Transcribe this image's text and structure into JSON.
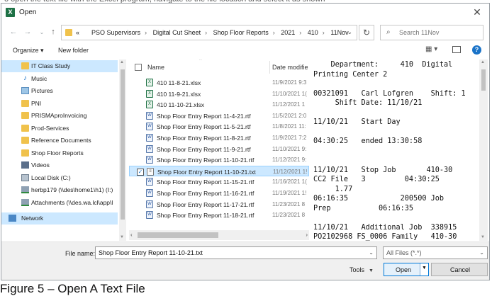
{
  "dialog": {
    "title": "Open",
    "close_glyph": "✕"
  },
  "nav": {
    "back": "←",
    "forward": "→",
    "recent": "⌄",
    "up": "↑",
    "breadcrumbs": [
      "«",
      "PSO Supervisors",
      "Digital Cut Sheet",
      "Shop Floor Reports",
      "2021",
      "410",
      "11Nov"
    ],
    "refresh": "↻",
    "search_placeholder": "Search 11Nov"
  },
  "toolbar": {
    "organize": "Organize ▾",
    "new_folder": "New folder",
    "view": "▦ ▾",
    "help": "?"
  },
  "sidebar": {
    "items": [
      {
        "label": "IT Class Study",
        "icon": "folder-icon",
        "selected": true
      },
      {
        "label": "Music",
        "icon": "music-icon"
      },
      {
        "label": "Pictures",
        "icon": "pictures-icon"
      },
      {
        "label": "PNI",
        "icon": "folder-icon"
      },
      {
        "label": "PRISMAproInvoicing",
        "icon": "folder-icon"
      },
      {
        "label": "Prod-Services",
        "icon": "folder-icon"
      },
      {
        "label": "Reference Documents",
        "icon": "folder-icon"
      },
      {
        "label": "Shop Floor Reports",
        "icon": "folder-icon"
      },
      {
        "label": "Videos",
        "icon": "videos-icon"
      },
      {
        "label": "Local Disk (C:)",
        "icon": "disk-icon"
      },
      {
        "label": "herbp179 (\\\\des\\home1\\h1) (I:)",
        "icon": "network-drive-icon"
      },
      {
        "label": "Attachments (\\\\des.wa.lcl\\app\\l",
        "icon": "network-drive-icon"
      },
      {
        "label": "Network",
        "icon": "network-icon",
        "selected": true
      }
    ]
  },
  "files": {
    "columns": {
      "name": "Name",
      "date": "Date modifie"
    },
    "rows": [
      {
        "name": "410 11-8-21.xlsx",
        "date": "11/9/2021 9:3",
        "type": "xl"
      },
      {
        "name": "410 11-9-21.xlsx",
        "date": "11/10/2021 1(",
        "type": "xl"
      },
      {
        "name": "410 11-10-21.xlsx",
        "date": "11/12/2021 1",
        "type": "xl"
      },
      {
        "name": "Shop Floor Entry Report 11-4-21.rtf",
        "date": "11/5/2021 2:0",
        "type": "rtf"
      },
      {
        "name": "Shop Floor Entry Report 11-5-21.rtf",
        "date": "11/8/2021 11:",
        "type": "rtf"
      },
      {
        "name": "Shop Floor Entry Report 11-8-21.rtf",
        "date": "11/9/2021 7:2",
        "type": "rtf"
      },
      {
        "name": "Shop Floor Entry Report 11-9-21.rtf",
        "date": "11/10/2021 9:",
        "type": "rtf"
      },
      {
        "name": "Shop Floor Entry Report 11-10-21.rtf",
        "date": "11/12/2021 9:",
        "type": "rtf"
      },
      {
        "name": "Shop Floor Entry Report 11-10-21.txt",
        "date": "11/12/2021 1!",
        "type": "txt",
        "selected": true
      },
      {
        "name": "Shop Floor Entry Report 11-15-21.rtf",
        "date": "11/16/2021 1(",
        "type": "rtf"
      },
      {
        "name": "Shop Floor Entry Report 11-16-21.rtf",
        "date": "11/19/2021 1!",
        "type": "rtf"
      },
      {
        "name": "Shop Floor Entry Report 11-17-21.rtf",
        "date": "11/23/2021 8",
        "type": "rtf"
      },
      {
        "name": "Shop Floor Entry Report 11-18-21.rtf",
        "date": "11/23/2021 8",
        "type": "rtf"
      }
    ]
  },
  "preview": {
    "lines": [
      "    Department:     410  Digital",
      "Printing Center 2",
      "",
      "00321091   Carl Lofgren    Shift: 1",
      "     Shift Date: 11/10/21",
      "",
      "11/10/21   Start Day",
      "",
      "04:30:25   ended 13:30:58",
      "",
      "",
      "11/10/21   Stop Job       410-30",
      "CC2 File   3         04:30:25",
      "     1.77",
      "06:16:35            200500 Job",
      "Prep           06:16:35",
      "",
      "11/10/21   Additional Job  338915",
      "PO2102968 FS_0006 Family   410-30"
    ]
  },
  "bottom": {
    "file_name_label": "File name:",
    "file_name_value": "Shop Floor Entry Report 11-10-21.txt",
    "file_type": "All Files (*.*)",
    "tools": "Tools",
    "open": "Open",
    "cancel": "Cancel"
  },
  "caption": "Figure 5 – Open A Text File"
}
